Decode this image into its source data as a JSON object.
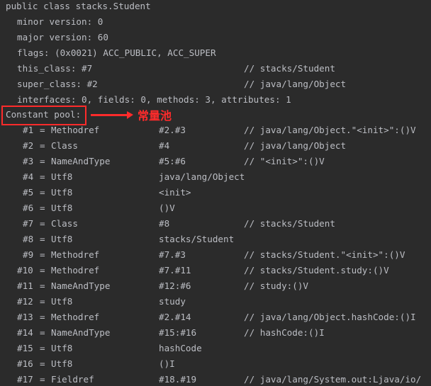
{
  "header": [
    {
      "text": "public class stacks.Student",
      "indent": 8
    },
    {
      "text": "minor version: 0",
      "indent": 24
    },
    {
      "text": "major version: 60",
      "indent": 24
    },
    {
      "text": "flags: (0x0021) ACC_PUBLIC, ACC_SUPER",
      "indent": 24
    },
    {
      "text": "this_class: #7",
      "indent": 24,
      "comment": "// stacks/Student"
    },
    {
      "text": "super_class: #2",
      "indent": 24,
      "comment": "// java/lang/Object"
    },
    {
      "text": "interfaces: 0, fields: 0, methods: 3, attributes: 1",
      "indent": 24
    }
  ],
  "constant_pool_label": "Constant pool:",
  "annotation": {
    "text": "常量池",
    "color": "#ff2b2b"
  },
  "entries": [
    {
      "idx": "#1",
      "type": "Methodref",
      "ref": "#2.#3",
      "comment": "// java/lang/Object.\"<init>\":()V"
    },
    {
      "idx": "#2",
      "type": "Class",
      "ref": "#4",
      "comment": "// java/lang/Object"
    },
    {
      "idx": "#3",
      "type": "NameAndType",
      "ref": "#5:#6",
      "comment": "// \"<init>\":()V"
    },
    {
      "idx": "#4",
      "type": "Utf8",
      "ref": "java/lang/Object",
      "comment": ""
    },
    {
      "idx": "#5",
      "type": "Utf8",
      "ref": "<init>",
      "comment": ""
    },
    {
      "idx": "#6",
      "type": "Utf8",
      "ref": "()V",
      "comment": ""
    },
    {
      "idx": "#7",
      "type": "Class",
      "ref": "#8",
      "comment": "// stacks/Student"
    },
    {
      "idx": "#8",
      "type": "Utf8",
      "ref": "stacks/Student",
      "comment": ""
    },
    {
      "idx": "#9",
      "type": "Methodref",
      "ref": "#7.#3",
      "comment": "// stacks/Student.\"<init>\":()V"
    },
    {
      "idx": "#10",
      "type": "Methodref",
      "ref": "#7.#11",
      "comment": "// stacks/Student.study:()V"
    },
    {
      "idx": "#11",
      "type": "NameAndType",
      "ref": "#12:#6",
      "comment": "// study:()V"
    },
    {
      "idx": "#12",
      "type": "Utf8",
      "ref": "study",
      "comment": ""
    },
    {
      "idx": "#13",
      "type": "Methodref",
      "ref": "#2.#14",
      "comment": "// java/lang/Object.hashCode:()I"
    },
    {
      "idx": "#14",
      "type": "NameAndType",
      "ref": "#15:#16",
      "comment": "// hashCode:()I"
    },
    {
      "idx": "#15",
      "type": "Utf8",
      "ref": "hashCode",
      "comment": ""
    },
    {
      "idx": "#16",
      "type": "Utf8",
      "ref": "()I",
      "comment": ""
    },
    {
      "idx": "#17",
      "type": "Fieldref",
      "ref": "#18.#19",
      "comment": "// java/lang/System.out:Ljava/io/"
    }
  ]
}
